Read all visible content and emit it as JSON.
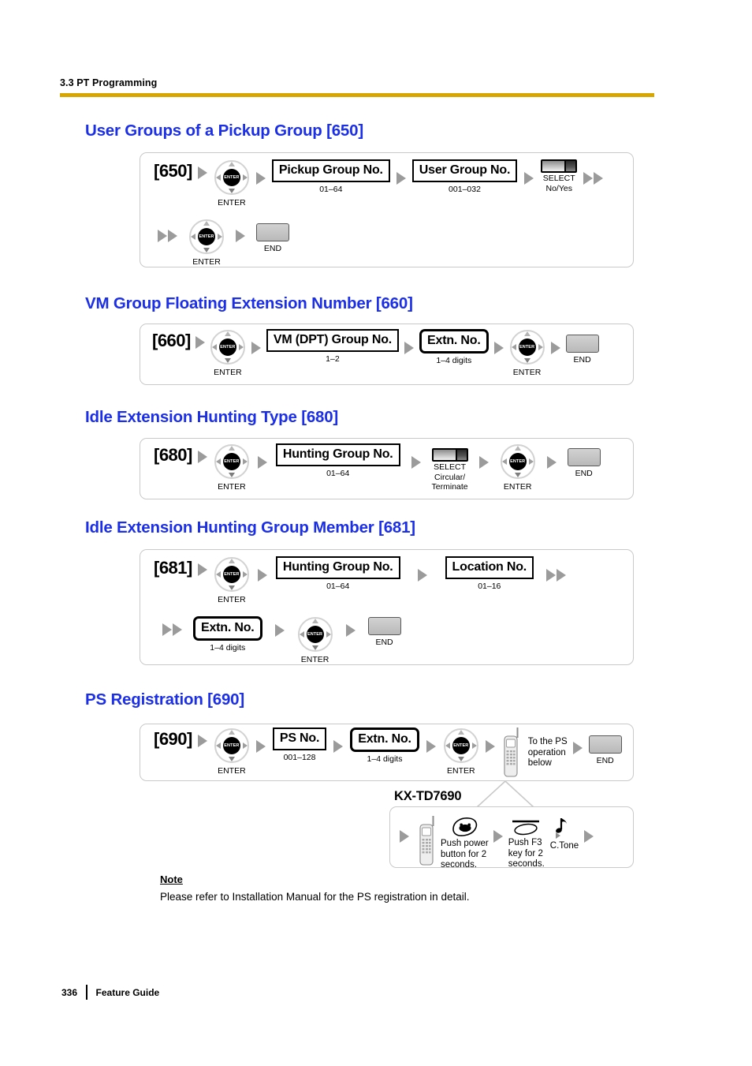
{
  "header": {
    "running_head": "3.3 PT Programming",
    "rule_color": "#d8a600"
  },
  "heading_color": "#1b2fe8",
  "icons": {
    "enter_center_text": "ENTER",
    "enter_label": "ENTER",
    "select_label": "SELECT",
    "end_label": "END"
  },
  "sections": [
    {
      "id": "650",
      "heading": "User Groups of a Pickup Group [650]",
      "code": "[650]",
      "row1": {
        "enter_label": "ENTER",
        "param1_label": "Pickup Group No.",
        "param1_range": "01–64",
        "param2_label": "User Group No.",
        "param2_range": "001–032",
        "select_label": "SELECT",
        "select_values": "No/Yes"
      },
      "row2": {
        "enter_label": "ENTER",
        "end_label": "END"
      }
    },
    {
      "id": "660",
      "heading": "VM Group Floating Extension Number [660]",
      "code": "[660]",
      "row1": {
        "enter_label": "ENTER",
        "param1_label": "VM (DPT) Group No.",
        "param1_range": "1–2",
        "param2_label": "Extn. No.",
        "param2_range": "1–4 digits",
        "enter2_label": "ENTER",
        "end_label": "END"
      }
    },
    {
      "id": "680",
      "heading": "Idle Extension Hunting Type [680]",
      "code": "[680]",
      "row1": {
        "enter_label": "ENTER",
        "param1_label": "Hunting Group No.",
        "param1_range": "01–64",
        "select_label": "SELECT",
        "select_values": "Circular/\nTerminate",
        "enter2_label": "ENTER",
        "end_label": "END"
      }
    },
    {
      "id": "681",
      "heading": "Idle Extension Hunting Group Member [681]",
      "code": "[681]",
      "row1": {
        "enter_label": "ENTER",
        "param1_label": "Hunting Group No.",
        "param1_range": "01–64",
        "param2_label": "Location No.",
        "param2_range": "01–16"
      },
      "row2": {
        "param3_label": "Extn. No.",
        "param3_range": "1–4 digits",
        "enter2_label": "ENTER",
        "end_label": "END"
      }
    },
    {
      "id": "690",
      "heading": "PS Registration [690]",
      "code": "[690]",
      "row1": {
        "enter_label": "ENTER",
        "param1_label": "PS No.",
        "param1_range": "001–128",
        "param2_label": "Extn. No.",
        "param2_range": "1–4 digits",
        "enter2_label": "ENTER",
        "ps_note": "To the PS\noperation\nbelow",
        "end_label": "END"
      }
    }
  ],
  "callout": {
    "model": "KX-TD7690",
    "step1": "Push power\nbutton for 2\nseconds.",
    "step2": "Push F3\nkey for 2\nseconds.",
    "step3": "C.Tone"
  },
  "note": {
    "title": "Note",
    "body": "Please refer to Installation Manual for the PS registration in detail."
  },
  "footer": {
    "page_number": "336",
    "document_name": "Feature Guide"
  }
}
